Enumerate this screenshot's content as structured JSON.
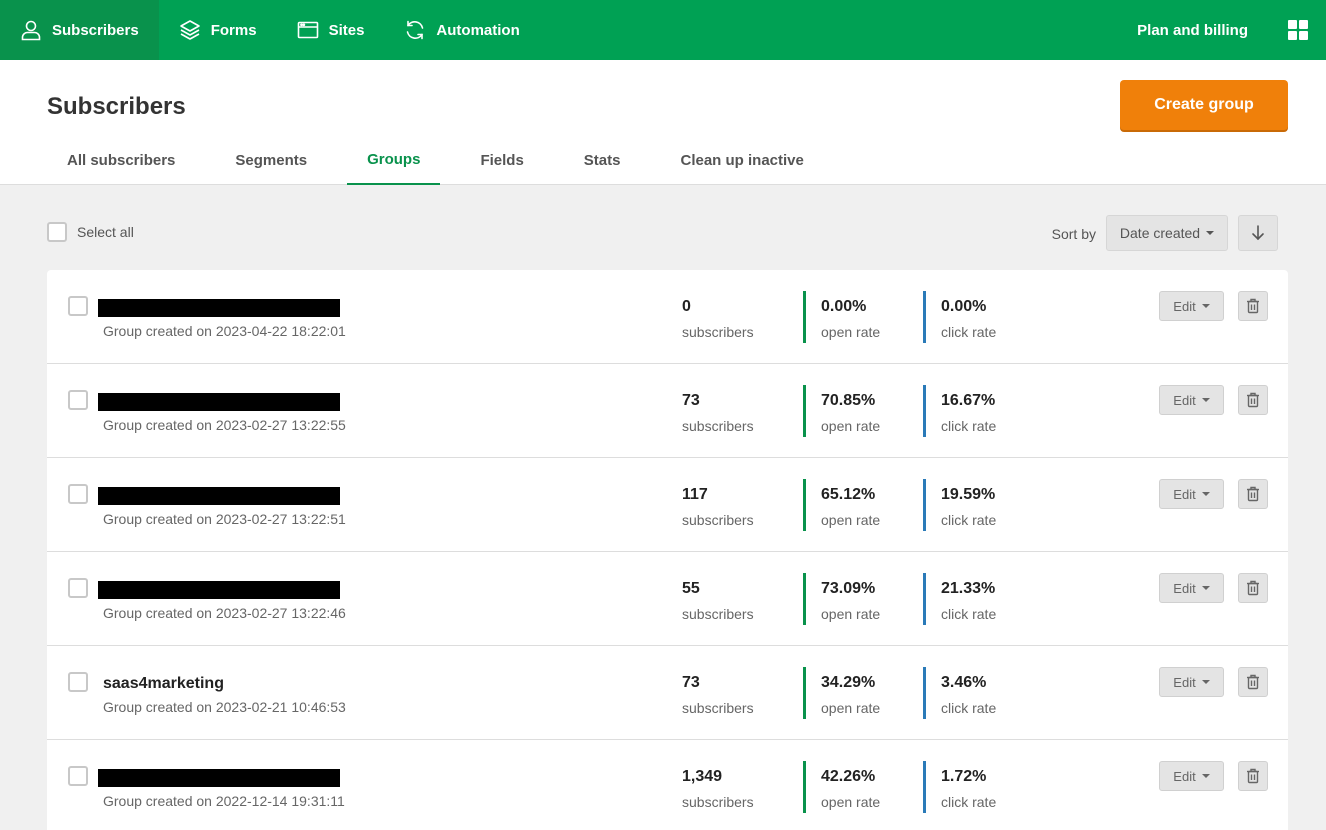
{
  "nav": {
    "items": [
      {
        "label": "Subscribers",
        "icon": "user-icon"
      },
      {
        "label": "Forms",
        "icon": "layers-icon"
      },
      {
        "label": "Sites",
        "icon": "browser-window-icon"
      },
      {
        "label": "Automation",
        "icon": "refresh-icon"
      }
    ],
    "plan_billing": "Plan and billing"
  },
  "header": {
    "title": "Subscribers",
    "create_button": "Create group",
    "tabs": [
      "All subscribers",
      "Segments",
      "Groups",
      "Fields",
      "Stats",
      "Clean up inactive"
    ],
    "active_tab": "Groups"
  },
  "toolbar": {
    "select_all": "Select all",
    "sort_label": "Sort by",
    "sort_value": "Date created"
  },
  "labels": {
    "subscribers": "subscribers",
    "open_rate": "open rate",
    "click_rate": "click rate",
    "edit": "Edit"
  },
  "colors": {
    "brand_green": "#00a154",
    "accent_orange": "#f0800a",
    "open_rate_bar": "#09924c",
    "click_rate_bar": "#2a7ab8"
  },
  "groups": [
    {
      "name": "",
      "redacted": true,
      "created": "Group created on 2023-04-22 18:22:01",
      "subscribers": "0",
      "open_rate": "0.00%",
      "click_rate": "0.00%"
    },
    {
      "name": "",
      "redacted": true,
      "created": "Group created on 2023-02-27 13:22:55",
      "subscribers": "73",
      "open_rate": "70.85%",
      "click_rate": "16.67%"
    },
    {
      "name": "",
      "redacted": true,
      "created": "Group created on 2023-02-27 13:22:51",
      "subscribers": "117",
      "open_rate": "65.12%",
      "click_rate": "19.59%"
    },
    {
      "name": "",
      "redacted": true,
      "created": "Group created on 2023-02-27 13:22:46",
      "subscribers": "55",
      "open_rate": "73.09%",
      "click_rate": "21.33%"
    },
    {
      "name": "saas4marketing",
      "redacted": false,
      "created": "Group created on 2023-02-21 10:46:53",
      "subscribers": "73",
      "open_rate": "34.29%",
      "click_rate": "3.46%"
    },
    {
      "name": "",
      "redacted": true,
      "created": "Group created on 2022-12-14 19:31:11",
      "subscribers": "1,349",
      "open_rate": "42.26%",
      "click_rate": "1.72%"
    }
  ]
}
